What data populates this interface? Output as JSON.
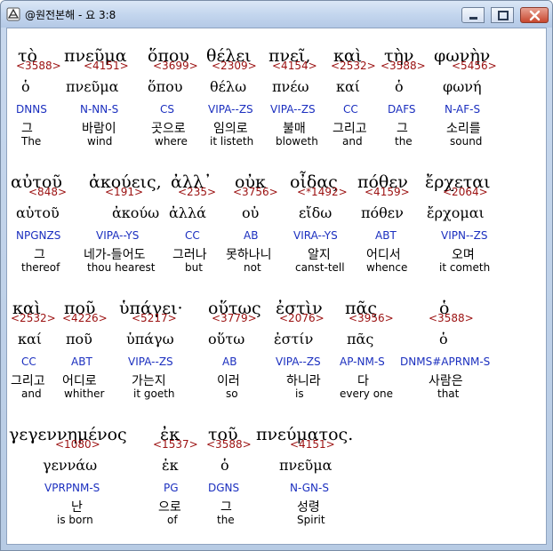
{
  "window": {
    "title": "@원전본해 - 요 3:8",
    "minimize_label": "minimize",
    "maximize_label": "maximize",
    "close_label": "close"
  },
  "verse_tokens": [
    {
      "greek": "τὸ",
      "strongs": "<3588>",
      "lemma": "ὁ",
      "morph": "DNNS",
      "korean": "그",
      "english": "The"
    },
    {
      "greek": "πνεῦμα",
      "strongs": "<4151>",
      "lemma": "πνεῦμα",
      "morph": "N-NN-S",
      "korean": "바람이",
      "english": "wind"
    },
    {
      "greek": "ὅπου",
      "strongs": "<3699>",
      "lemma": "ὅπου",
      "morph": "CS",
      "korean": "곳으로",
      "english": "where"
    },
    {
      "greek": "θέλει",
      "strongs": "<2309>",
      "lemma": "θέλω",
      "morph": "VIPA--ZS",
      "korean": "임의로",
      "english": "it listeth"
    },
    {
      "greek": "πνεῖ,",
      "strongs": "<4154>",
      "lemma": "πνέω",
      "morph": "VIPA--ZS",
      "korean": "불매",
      "english": "bloweth"
    },
    {
      "greek": "καὶ",
      "strongs": "<2532>",
      "lemma": "καί",
      "morph": "CC",
      "korean": "그리고",
      "english": "and"
    },
    {
      "greek": "τὴν",
      "strongs": "<3588>",
      "lemma": "ὁ",
      "morph": "DAFS",
      "korean": "그",
      "english": "the"
    },
    {
      "greek": "φωνὴν",
      "strongs": "<5456>",
      "lemma": "φωνή",
      "morph": "N-AF-S",
      "korean": "소리를",
      "english": "sound"
    },
    {
      "greek": "αὐτοῦ",
      "strongs": "<848>",
      "lemma": "αὑτοῦ",
      "morph": "NPGNZS",
      "korean": "그",
      "english": "thereof"
    },
    {
      "greek": "ἀκούεις,",
      "strongs": "<191>",
      "lemma": "ἀκούω",
      "morph": "VIPA--YS",
      "korean": "네가-들어도",
      "english": "thou hearest"
    },
    {
      "greek": "ἀλλ᾽",
      "strongs": "<235>",
      "lemma": "ἀλλά",
      "morph": "CC",
      "korean": "그러나",
      "english": "but"
    },
    {
      "greek": "οὐκ",
      "strongs": "<3756>",
      "lemma": "οὐ",
      "morph": "AB",
      "korean": "못하나니",
      "english": "not"
    },
    {
      "greek": "οἶδας",
      "strongs": "<*1492>",
      "lemma": "εἴδω",
      "morph": "VIRA--YS",
      "korean": "알지",
      "english": "canst-tell"
    },
    {
      "greek": "πόθεν",
      "strongs": "<4159>",
      "lemma": "πόθεν",
      "morph": "ABT",
      "korean": "어디서",
      "english": "whence"
    },
    {
      "greek": "ἔρχεται",
      "strongs": "<2064>",
      "lemma": "ἔρχομαι",
      "morph": "VIPN--ZS",
      "korean": "오며",
      "english": "it cometh"
    },
    {
      "greek": "καὶ",
      "strongs": "<2532>",
      "lemma": "καί",
      "morph": "CC",
      "korean": "그리고",
      "english": "and"
    },
    {
      "greek": "ποῦ",
      "strongs": "<4226>",
      "lemma": "ποῦ",
      "morph": "ABT",
      "korean": "어디로",
      "english": "whither"
    },
    {
      "greek": "ὑπάγει·",
      "strongs": "<5217>",
      "lemma": "ὑπάγω",
      "morph": "VIPA--ZS",
      "korean": "가는지",
      "english": "it goeth"
    },
    {
      "greek": "οὕτως",
      "strongs": "<3779>",
      "lemma": "οὕτω",
      "morph": "AB",
      "korean": "이러",
      "english": "so"
    },
    {
      "greek": "ἐστὶν",
      "strongs": "<2076>",
      "lemma": "ἐστίν",
      "morph": "VIPA--ZS",
      "korean": "하니라",
      "english": "is"
    },
    {
      "greek": "πᾶς",
      "strongs": "<3956>",
      "lemma": "πᾶς",
      "morph": "AP-NM-S",
      "korean": "다",
      "english": "every one"
    },
    {
      "greek": "ὁ",
      "strongs": "<3588>",
      "lemma": "ὁ",
      "morph": "DNMS#APRNM-S",
      "korean": "사람은",
      "english": "that"
    },
    {
      "greek": "γεγεννημένος",
      "strongs": "<1080>",
      "lemma": "γεννάω",
      "morph": "VPRPNM-S",
      "korean": "난",
      "english": "is born"
    },
    {
      "greek": "ἐκ",
      "strongs": "<1537>",
      "lemma": "ἐκ",
      "morph": "PG",
      "korean": "으로",
      "english": "of"
    },
    {
      "greek": "τοῦ",
      "strongs": "<3588>",
      "lemma": "ὁ",
      "morph": "DGNS",
      "korean": "그",
      "english": "the"
    },
    {
      "greek": "πνεύματος.",
      "strongs": "<4151>",
      "lemma": "πνεῦμα",
      "morph": "N-GN-S",
      "korean": "성령",
      "english": "Spirit"
    }
  ],
  "colors": {
    "strongs": "#9b1010",
    "morph": "#1b2fbf",
    "text": "#000000",
    "background": "#ffffff"
  }
}
